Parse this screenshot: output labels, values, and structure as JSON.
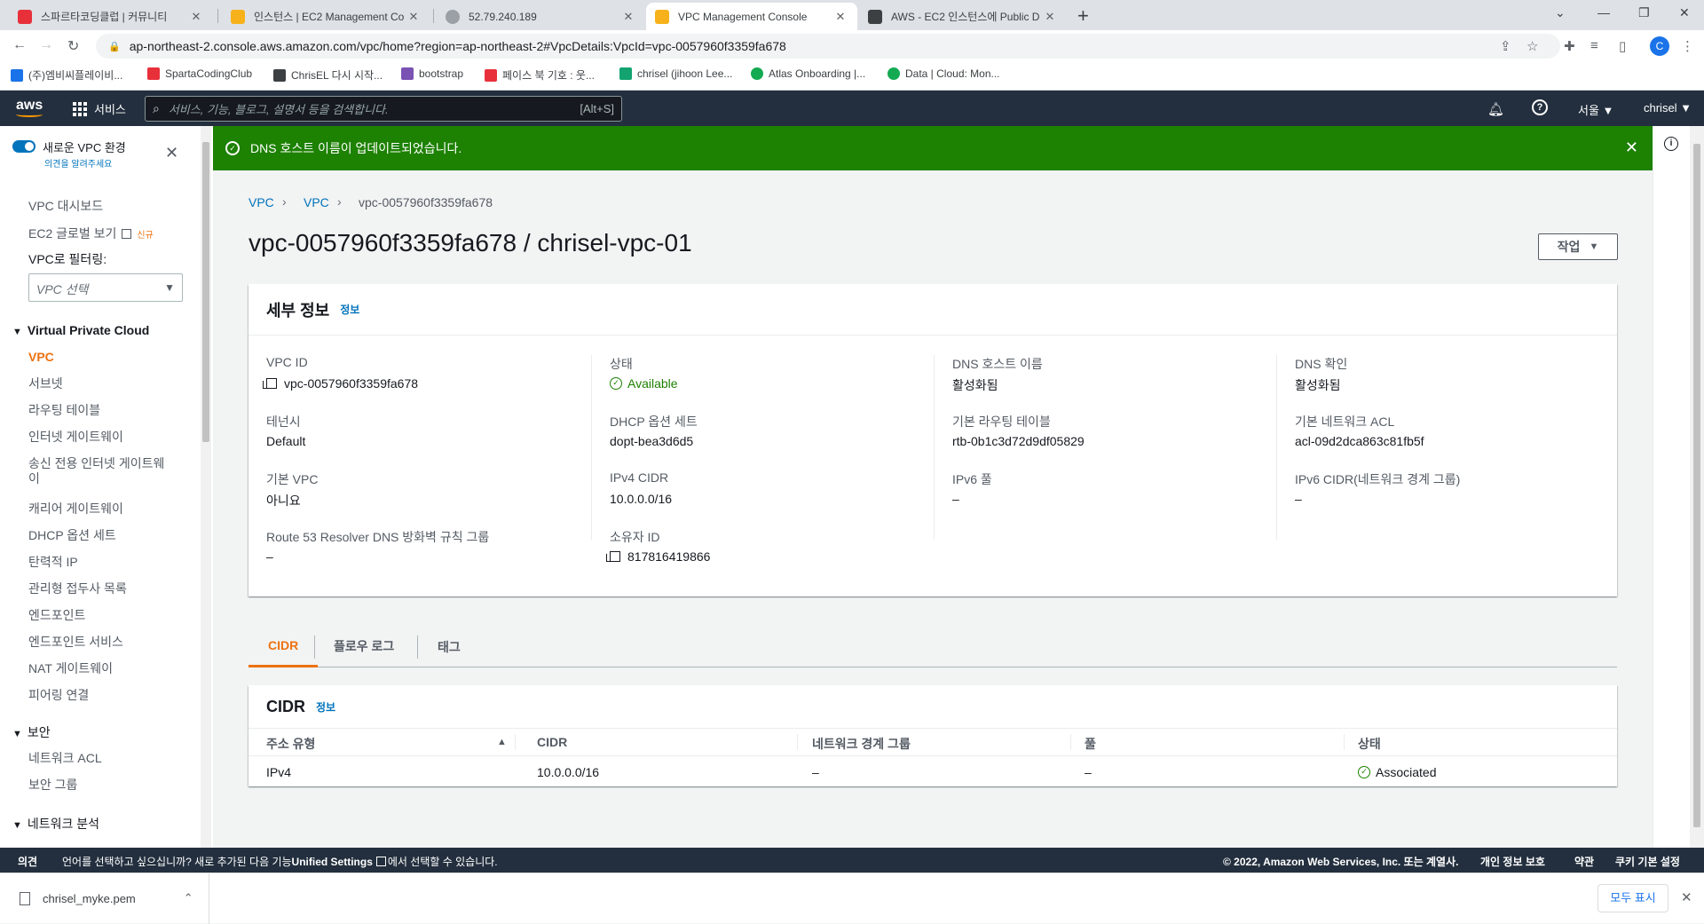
{
  "browser": {
    "tabs": [
      {
        "title": "스파르타코딩클럽 | 커뮤니티",
        "color": "#e8303b"
      },
      {
        "title": "인스턴스 | EC2 Management Co",
        "color": "#f7b21b"
      },
      {
        "title": "52.79.240.189",
        "color": "#5f6368"
      },
      {
        "title": "VPC Management Console",
        "color": "#f7b21b"
      },
      {
        "title": "AWS - EC2 인스턴스에 Public D",
        "color": "#3c4043"
      }
    ],
    "url": "ap-northeast-2.console.aws.amazon.com/vpc/home?region=ap-northeast-2#VpcDetails:VpcId=vpc-0057960f3359fa678",
    "profile_initial": "C",
    "bookmarks": [
      {
        "label": "(주)엠비씨플레이비...",
        "color": "#1a73e8"
      },
      {
        "label": "SpartaCodingClub",
        "color": "#e8303b"
      },
      {
        "label": "ChrisEL 다시 시작...",
        "color": "#3c4043"
      },
      {
        "label": "bootstrap",
        "color": "#7952b3"
      },
      {
        "label": "페이스 북 기호 : 웃...",
        "color": "#e8303b"
      },
      {
        "label": "chrisel (jihoon Lee...",
        "color": "#12a370"
      },
      {
        "label": "Atlas Onboarding |...",
        "color": "#13aa52"
      },
      {
        "label": "Data | Cloud: Mon...",
        "color": "#13aa52"
      }
    ]
  },
  "aws": {
    "logo": "aws",
    "services_label": "서비스",
    "search_placeholder": "서비스, 기능, 블로그, 설명서 등을 검색합니다.",
    "search_shortcut": "[Alt+S]",
    "region": "서울 ▼",
    "user": "chrisel ▼"
  },
  "sidebar": {
    "new_vpc_label": "새로운 VPC 환경",
    "feedback_label": "의견을 알려주세요",
    "dashboard": "VPC 대시보드",
    "ec2_global": "EC2 글로벌 보기",
    "new_badge": "신규",
    "filter_label": "VPC로 필터링:",
    "filter_placeholder": "VPC 선택",
    "section_vpc": "Virtual Private Cloud",
    "items": [
      "VPC",
      "서브넷",
      "라우팅 테이블",
      "인터넷 게이트웨이",
      "송신 전용 인터넷 게이트웨이",
      "캐리어 게이트웨이",
      "DHCP 옵션 세트",
      "탄력적 IP",
      "관리형 접두사 목록",
      "엔드포인트",
      "엔드포인트 서비스",
      "NAT 게이트웨이",
      "피어링 연결"
    ],
    "section_security": "보안",
    "security_items": [
      "네트워크 ACL",
      "보안 그룹"
    ],
    "section_network": "네트워크 분석"
  },
  "flash": {
    "message": "DNS 호스트 이름이 업데이트되었습니다."
  },
  "breadcrumb": [
    "VPC",
    "VPC",
    "vpc-0057960f3359fa678"
  ],
  "page_title": "vpc-0057960f3359fa678 / chrisel-vpc-01",
  "actions_label": "작업",
  "details": {
    "title": "세부 정보",
    "info_link": "정보",
    "vpc_id_label": "VPC ID",
    "vpc_id": "vpc-0057960f3359fa678",
    "tenancy_label": "테넌시",
    "tenancy": "Default",
    "default_vpc_label": "기본 VPC",
    "default_vpc": "아니요",
    "route53_label": "Route 53 Resolver DNS 방화벽 규칙 그룹",
    "route53": "–",
    "state_label": "상태",
    "state": "Available",
    "dhcp_label": "DHCP 옵션 세트",
    "dhcp": "dopt-bea3d6d5",
    "ipv4_label": "IPv4 CIDR",
    "ipv4": "10.0.0.0/16",
    "owner_label": "소유자 ID",
    "owner": "817816419866",
    "dns_host_label": "DNS 호스트 이름",
    "dns_host": "활성화됨",
    "main_rt_label": "기본 라우팅 테이블",
    "main_rt": "rtb-0b1c3d72d9df05829",
    "ipv6_pool_label": "IPv6 풀",
    "ipv6_pool": "–",
    "dns_res_label": "DNS 확인",
    "dns_res": "활성화됨",
    "main_acl_label": "기본 네트워크 ACL",
    "main_acl": "acl-09d2dca863c81fb5f",
    "ipv6_cidr_label": "IPv6 CIDR(네트워크 경계 그룹)",
    "ipv6_cidr": "–"
  },
  "tabs": [
    "CIDR",
    "플로우 로그",
    "태그"
  ],
  "cidr_table": {
    "title": "CIDR",
    "info_link": "정보",
    "columns": [
      "주소 유형",
      "CIDR",
      "네트워크 경계 그룹",
      "풀",
      "상태"
    ],
    "rows": [
      [
        "IPv4",
        "10.0.0.0/16",
        "–",
        "–",
        "Associated"
      ]
    ]
  },
  "footer": {
    "feedback": "의견",
    "lang_pre": "언어를 선택하고 싶으십니까? 새로 추가된 다음 기능",
    "lang_link": "Unified Settings",
    "lang_post": "에서 선택할 수 있습니다.",
    "copyright": "© 2022, Amazon Web Services, Inc. 또는 계열사.",
    "privacy": "개인 정보 보호",
    "terms": "약관",
    "cookies": "쿠키 기본 설정"
  },
  "download": {
    "file": "chrisel_myke.pem",
    "show_all": "모두 표시"
  }
}
